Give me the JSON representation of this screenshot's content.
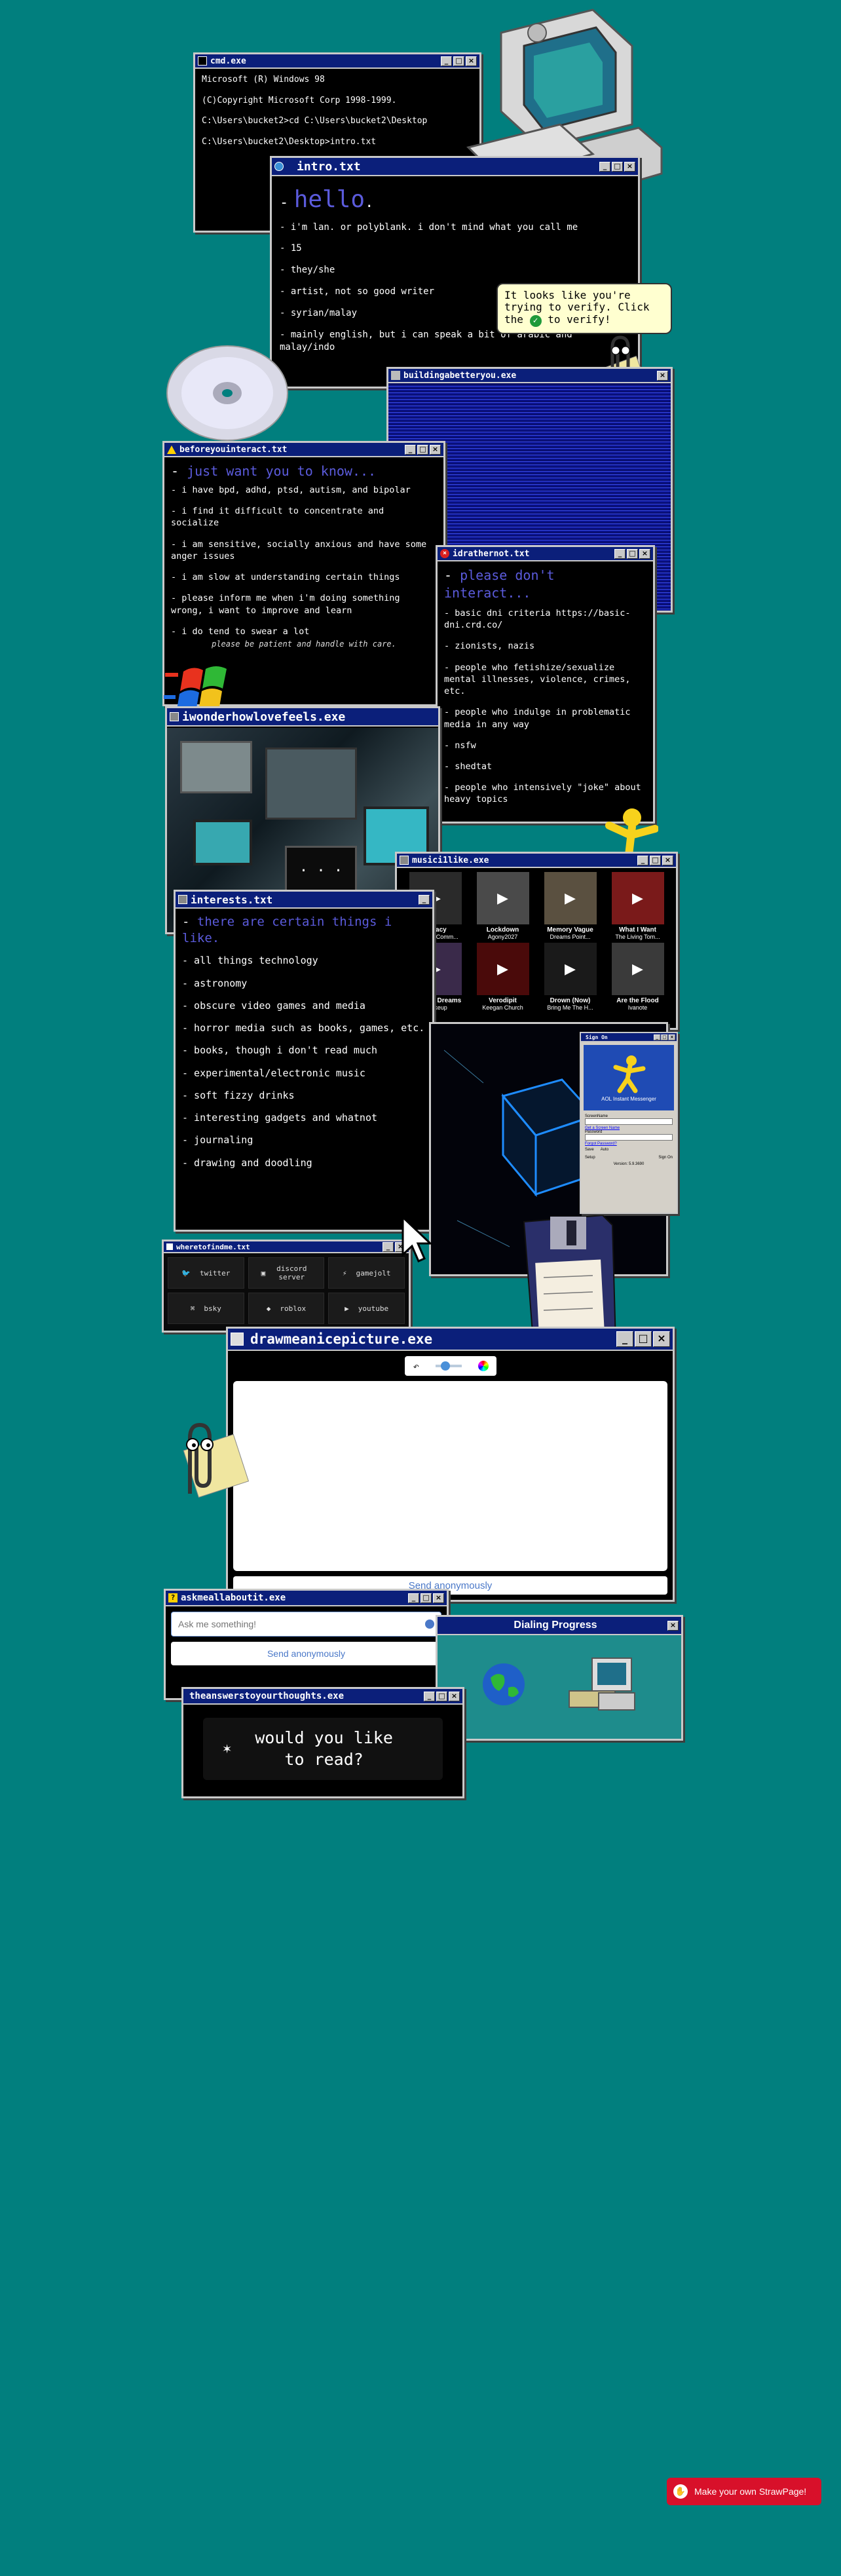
{
  "cmd": {
    "title": "cmd.exe",
    "lines": [
      "Microsoft (R) Windows 98",
      "(C)Copyright Microsoft Corp 1998-1999.",
      "C:\\Users\\bucket2>cd C:\\Users\\bucket2\\Desktop",
      "C:\\Users\\bucket2\\Desktop>intro.txt"
    ]
  },
  "intro": {
    "title": "intro.txt",
    "heading_dash": "-",
    "heading": "hello",
    "heading_dot": ".",
    "items": [
      "- i'm lan. or polyblank. i don't mind what you call me",
      "- 15",
      "- they/she",
      "- artist, not so good writer",
      "- syrian/malay",
      "- mainly english, but i can speak a bit of arabic and malay/indo"
    ]
  },
  "tooltip": {
    "line1": "It looks like you're",
    "line2": "trying to verify. Click",
    "line3a": "the",
    "line3b": "to verify!"
  },
  "better": {
    "title": "buildingabetteryou.exe"
  },
  "before": {
    "title": "beforeyouinteract.txt",
    "heading": "just want you to know...",
    "items": [
      "- i have bpd, adhd, ptsd, autism, and bipolar",
      "- i find it difficult to concentrate and socialize",
      "- i am sensitive, socially anxious and have some anger issues",
      "- i am slow at understanding certain things",
      "- please inform me when i'm doing something wrong, i want to improve and learn",
      "- i do tend to swear a lot"
    ],
    "note": "please be patient and handle with care."
  },
  "idrather": {
    "title": "idrathernot.txt",
    "heading": "please don't interact...",
    "items": [
      "- basic dni criteria https://basic-dni.crd.co/",
      "- zionists, nazis",
      "- people who fetishize/sexualize mental illnesses, violence, crimes, etc.",
      "- people who indulge in problematic media in any way",
      "- nsfw",
      "- shedtat",
      "- people who intensively \"joke\" about heavy topics"
    ]
  },
  "wonder": {
    "title": "iwonderhowlovefeels.exe",
    "dots": ". . ."
  },
  "music": {
    "title": "musici1like.exe",
    "songs": [
      {
        "name": "Legacy",
        "artist": "Oatmeal Comm..."
      },
      {
        "name": "Lockdown",
        "artist": "Agony2027"
      },
      {
        "name": "Memory Vague",
        "artist": "Dreams Point..."
      },
      {
        "name": "What I Want",
        "artist": "The Living Tom..."
      },
      {
        "name": "Delirium Dreams",
        "artist": "Invokeup"
      },
      {
        "name": "Verodipit",
        "artist": "Keegan Church"
      },
      {
        "name": "Drown (Now)",
        "artist": "Bring Me The H..."
      },
      {
        "name": "Are the Flood",
        "artist": "Ivanote"
      }
    ]
  },
  "interests": {
    "title": "interests.txt",
    "heading": "there are certain things i like.",
    "items": [
      "- all things technology",
      "- astronomy",
      "- obscure video games and media",
      "- horror media such as books, games, etc.",
      "- books, though i don't read much",
      "- experimental/electronic music",
      "- soft fizzy drinks",
      "- interesting gadgets and whatnot",
      "- journaling",
      "- drawing and doodling"
    ]
  },
  "aim": {
    "title": "Sign On",
    "brand": "AOL Instant Messenger",
    "screen_label": "ScreenName",
    "link1": "Get a Screen Name",
    "password_label": "Password",
    "link2": "Forgot Password?",
    "save": "Save",
    "auto": "Auto",
    "setup": "Setup",
    "signon": "Sign On",
    "version": "Version: 5.9.3690"
  },
  "where": {
    "title": "wheretofindme.txt",
    "links": [
      "twitter",
      "discord server",
      "gamejolt",
      "bsky",
      "roblox",
      "youtube"
    ]
  },
  "draw": {
    "title": "drawmeanicepicture.exe",
    "send": "Send anonymously"
  },
  "ask": {
    "title": "askmeallaboutit.exe",
    "placeholder": "Ask me something!",
    "send": "Send anonymously"
  },
  "dialing": {
    "title": "Dialing Progress"
  },
  "answers": {
    "title": "theanswerstoyourthoughts.exe",
    "text_line1": "would you like",
    "text_line2": "to read?"
  },
  "strawpage": {
    "label": "Make your own StrawPage!"
  },
  "colors": {
    "bg": "#017f7e",
    "title": "#0b1f7a",
    "accent": "#5b5bdc",
    "strawpage": "#d8102a"
  }
}
